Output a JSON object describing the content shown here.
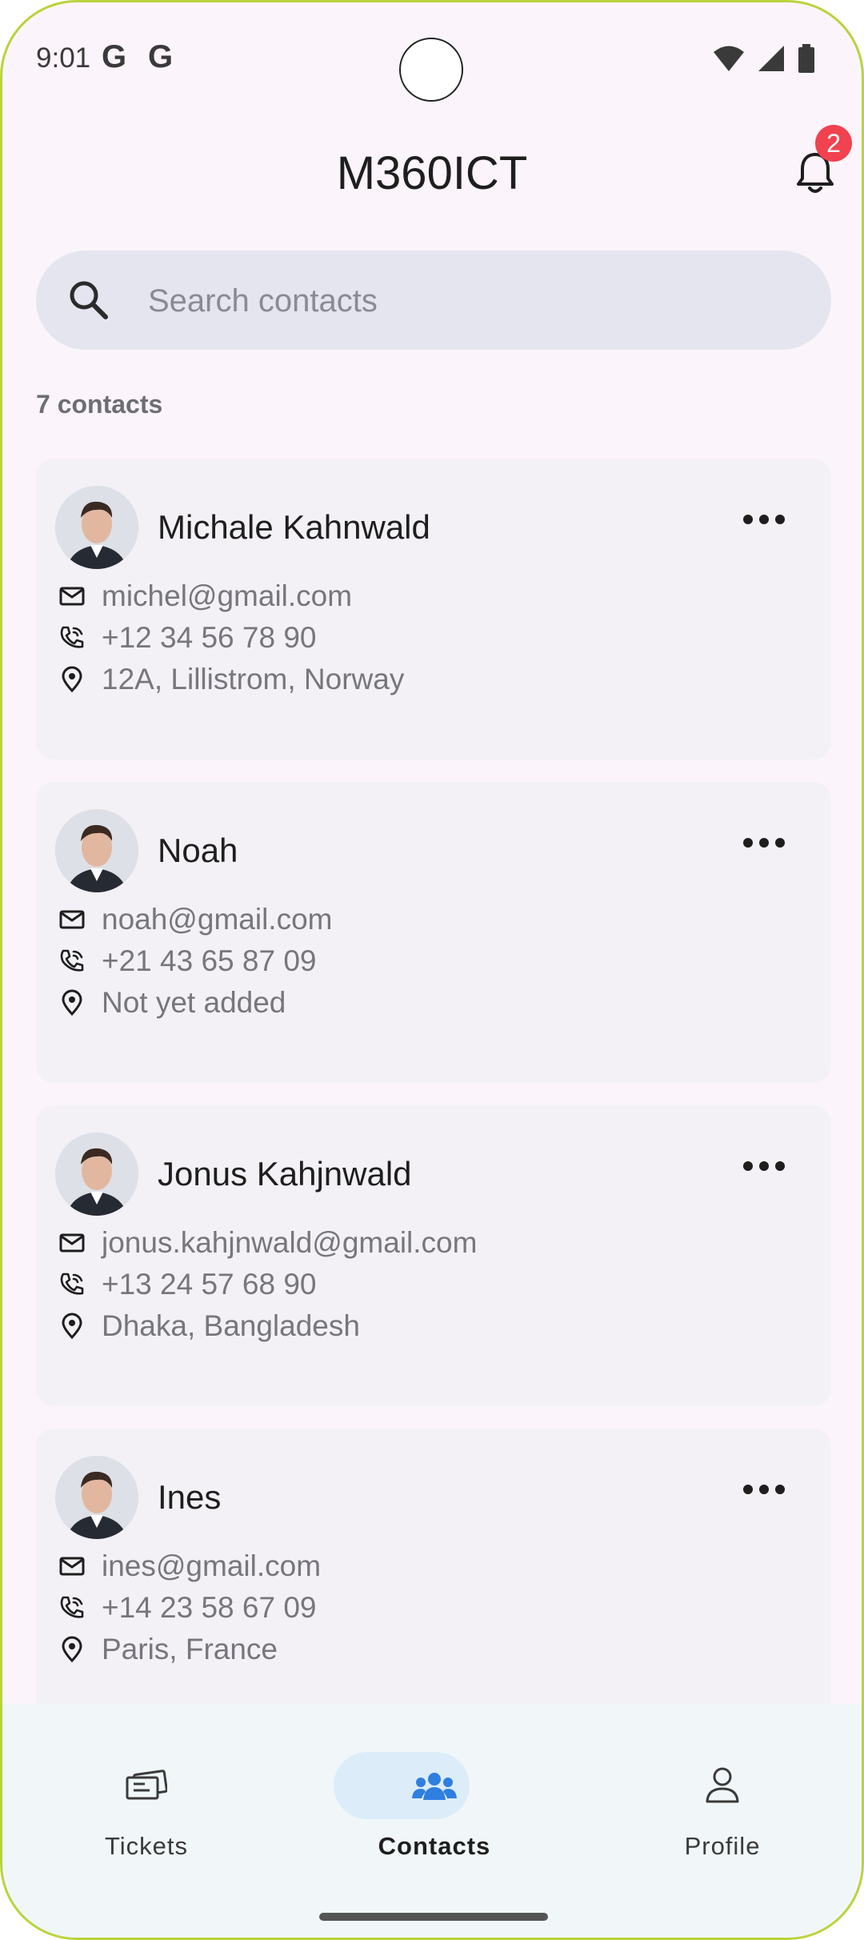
{
  "status_bar": {
    "time": "9:01",
    "g1": "G",
    "g2": "G"
  },
  "app": {
    "title": "M360ICT",
    "notification_count": "2"
  },
  "search": {
    "placeholder": "Search contacts"
  },
  "contacts_count": "7 contacts",
  "contacts": [
    {
      "name": "Michale Kahnwald",
      "email": "michel@gmail.com",
      "phone": "+12 34 56 78 90",
      "address": "12A, Lillistrom, Norway"
    },
    {
      "name": "Noah",
      "email": "noah@gmail.com",
      "phone": "+21 43 65 87 09",
      "address": "Not yet added"
    },
    {
      "name": "Jonus Kahjnwald",
      "email": "jonus.kahjnwald@gmail.com",
      "phone": "+13 24 57 68 90",
      "address": "Dhaka, Bangladesh"
    },
    {
      "name": "Ines",
      "email": "ines@gmail.com",
      "phone": "+14 23 58 67 09",
      "address": "Paris, France"
    }
  ],
  "nav": {
    "tickets": "Tickets",
    "contacts": "Contacts",
    "profile": "Profile"
  },
  "colors": {
    "accent": "#2f7fe0",
    "badge": "#f0424f",
    "nav_pill": "#dcedf9"
  }
}
